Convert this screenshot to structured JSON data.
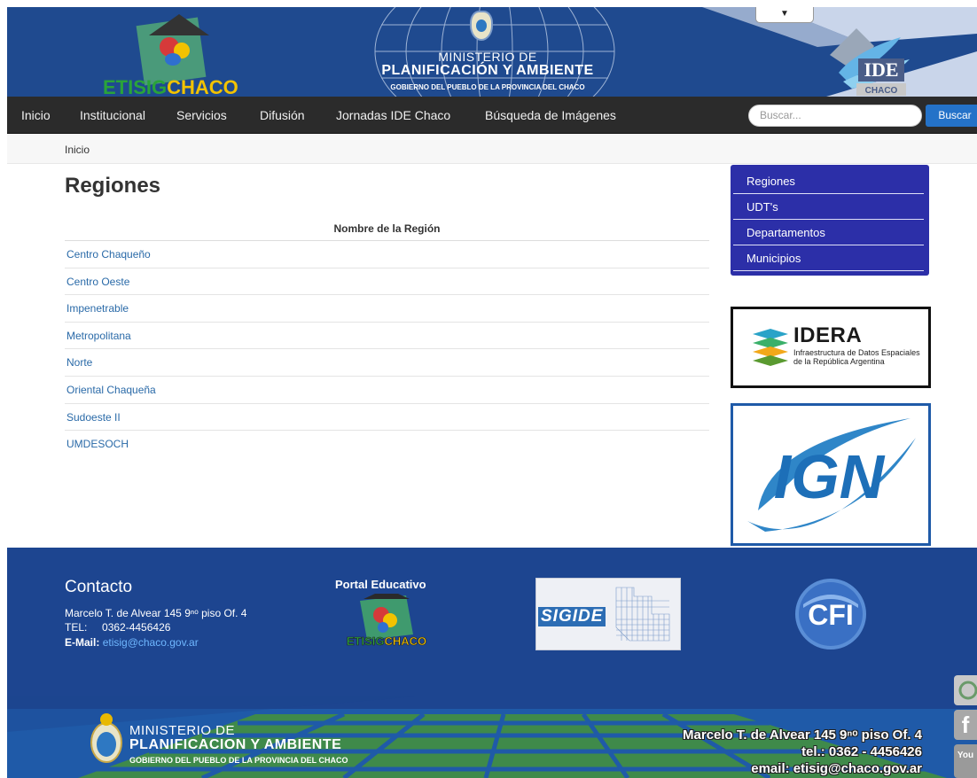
{
  "header": {
    "brand_part1": "ETISIG",
    "brand_part2": "CHACO",
    "ministry_line1": "MINISTERIO DE",
    "ministry_line2": "PLANIFICACIÓN Y AMBIENTE",
    "ministry_line3": "GOBIERNO DEL PUEBLO DE LA PROVINCIA DEL CHACO",
    "dropdown_glyph": "▼",
    "ide_text": "IDE",
    "ide_sub": "CHACO"
  },
  "nav": {
    "items": [
      "Inicio",
      "Institucional",
      "Servicios",
      "Difusión",
      "Jornadas IDE Chaco",
      "Búsqueda de Imágenes"
    ],
    "search_placeholder": "Buscar...",
    "search_button": "Buscar"
  },
  "breadcrumb": "Inicio",
  "page_title": "Regiones",
  "regions_table": {
    "header": "Nombre de la Región",
    "rows": [
      "Centro Chaqueño",
      "Centro Oeste",
      "Impenetrable",
      "Metropolitana",
      "Norte",
      "Oriental Chaqueña",
      "Sudoeste II",
      "UMDESOCH"
    ]
  },
  "side_menu": [
    "Regiones",
    "UDT's",
    "Departamentos",
    "Municipios"
  ],
  "idera": {
    "title": "IDERA",
    "sub1": "Infraestructura de Datos Espaciales",
    "sub2": "de la República Argentina"
  },
  "ign_text": "IGN",
  "footer": {
    "contact_title": "Contacto",
    "address": "Marcelo T. de Alvear 145 9ⁿᵒ piso Of. 4",
    "tel_label": "TEL:",
    "tel_value": "0362-4456426",
    "email_label": "E-Mail:",
    "email_value": "etisig@chaco.gov.ar",
    "portal_title": "Portal Educativo",
    "portal_brand1": "ETISIG",
    "portal_brand2": "CHACO",
    "sigide_text": "SIGIDE",
    "cfi_text": "CFI"
  },
  "bottom": {
    "line1": "MINISTERIO DE",
    "line2": "PLANIFICACION Y AMBIENTE",
    "line3": "GOBIERNO DEL PUEBLO DE LA PROVINCIA DEL CHACO",
    "addr": "Marcelo T. de Alvear 145 9ⁿᵒ piso Of. 4",
    "tel": "tel.: 0362 - 4456426",
    "email": "email: etisig@chaco.gov.ar"
  },
  "social": {
    "facebook_glyph": "f",
    "youtube_glyph": "You"
  }
}
